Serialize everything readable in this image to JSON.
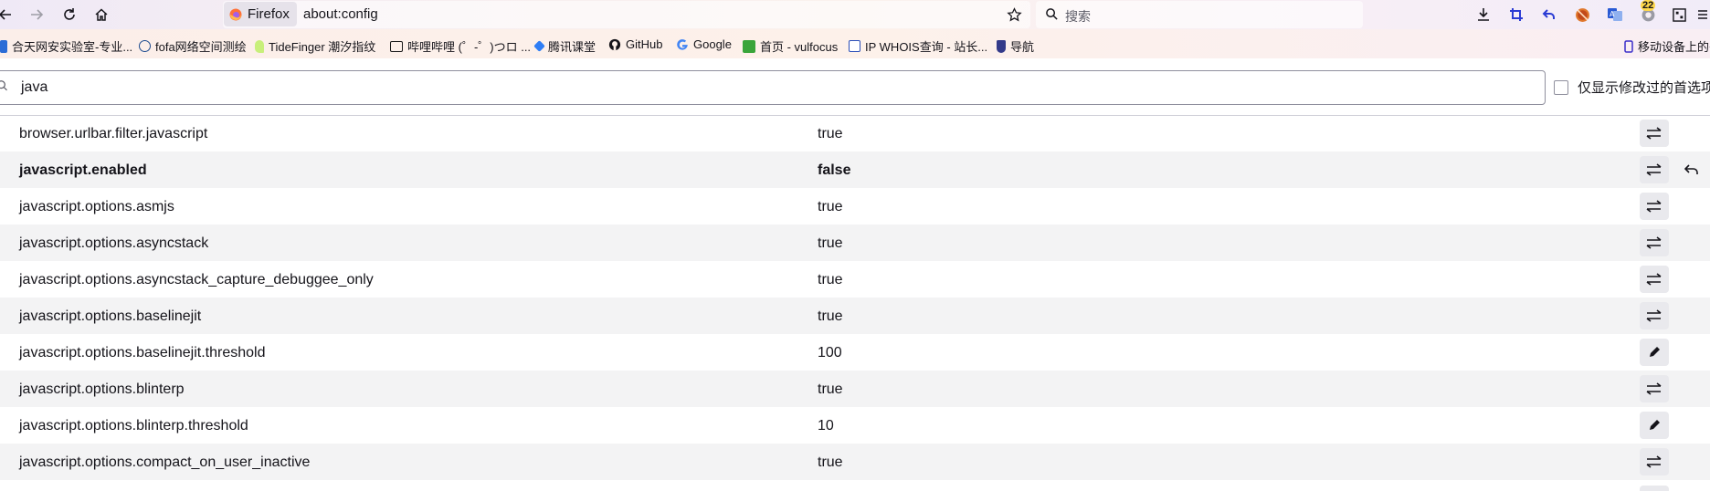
{
  "toolbar": {
    "identity_label": "Firefox",
    "url": "about:config",
    "search_placeholder": "搜索",
    "badge_count": "22"
  },
  "bookmarks": [
    {
      "label": "合天网安实验室-专业...",
      "icon": "hetian-favicon",
      "color": "#2b6cd6"
    },
    {
      "label": "fofa网络空间测绘",
      "icon": "fofa-favicon",
      "color": "#1c4a8e"
    },
    {
      "label": "TideFinger 潮汐指纹",
      "icon": "tidefinger-favicon",
      "color": "#a8e063"
    },
    {
      "label": "哔哩哔哩 (゜-゜)つロ ...",
      "icon": "bilibili-favicon",
      "color": "#1a1a1a"
    },
    {
      "label": "腾讯课堂",
      "icon": "tencent-classroom-favicon",
      "color": "#2f7ef5"
    },
    {
      "label": "GitHub",
      "icon": "github-favicon",
      "color": "#15141a"
    },
    {
      "label": "Google",
      "icon": "google-favicon",
      "color": "#4285f4"
    },
    {
      "label": "首页 - vulfocus",
      "icon": "vulfocus-favicon",
      "color": "#3aa53a"
    },
    {
      "label": "IP WHOIS查询 - 站长...",
      "icon": "whois-favicon",
      "color": "#2b4fb8"
    },
    {
      "label": "导航",
      "icon": "nav-favicon",
      "color": "#333a8a"
    }
  ],
  "mobile_bookmarks_label": "移动设备上的书",
  "config": {
    "search_value": "java",
    "modified_only_label": "仅显示修改过的首选项",
    "prefs": [
      {
        "name": "browser.urlbar.filter.javascript",
        "value": "true",
        "action": "toggle"
      },
      {
        "name": "javascript.enabled",
        "value": "false",
        "action": "toggle",
        "modified": true
      },
      {
        "name": "javascript.options.asmjs",
        "value": "true",
        "action": "toggle"
      },
      {
        "name": "javascript.options.asyncstack",
        "value": "true",
        "action": "toggle"
      },
      {
        "name": "javascript.options.asyncstack_capture_debuggee_only",
        "value": "true",
        "action": "toggle"
      },
      {
        "name": "javascript.options.baselinejit",
        "value": "true",
        "action": "toggle"
      },
      {
        "name": "javascript.options.baselinejit.threshold",
        "value": "100",
        "action": "edit"
      },
      {
        "name": "javascript.options.blinterp",
        "value": "true",
        "action": "toggle"
      },
      {
        "name": "javascript.options.blinterp.threshold",
        "value": "10",
        "action": "edit"
      },
      {
        "name": "javascript.options.compact_on_user_inactive",
        "value": "true",
        "action": "toggle"
      }
    ]
  },
  "colors": {
    "accent_blue": "#0061e0",
    "toolbar_icon": "#15141a",
    "crop_icon": "#2a3bd4"
  }
}
